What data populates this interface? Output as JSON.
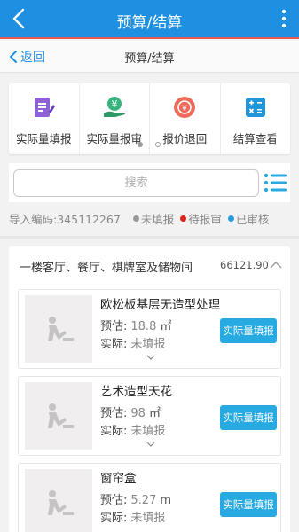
{
  "appbar": {
    "title": "预算/结算"
  },
  "subbar": {
    "back_label": "返回",
    "title": "预算/结算"
  },
  "actions": [
    {
      "label": "实际量填报",
      "icon": "edit-icon",
      "color": "#8e62d6"
    },
    {
      "label": "实际量报审",
      "icon": "money-hand-icon",
      "color": "#36b37e"
    },
    {
      "label": "报价退回",
      "icon": "return-icon",
      "color": "#ef6a5c"
    },
    {
      "label": "结算查看",
      "icon": "calculator-icon",
      "color": "#2196d8"
    }
  ],
  "search": {
    "placeholder": "搜索"
  },
  "legend": {
    "code": "导入编码:345112267",
    "statuses": [
      {
        "label": "未填报",
        "color": "#999999"
      },
      {
        "label": "待报审",
        "color": "#d9231b"
      },
      {
        "label": "已审核",
        "color": "#2b9be0"
      }
    ]
  },
  "section": {
    "title": "一楼客厅、餐厅、棋牌室及储物间",
    "total": "66121.90",
    "items": [
      {
        "name": "欧松板基层无造型处理",
        "est_label": "预估:",
        "est_value": "18.8",
        "est_unit": "㎡",
        "act_label": "实际:",
        "act_value": "未填报",
        "button": "实际量填报"
      },
      {
        "name": "艺术造型天花",
        "est_label": "预估:",
        "est_value": "98",
        "est_unit": "㎡",
        "act_label": "实际:",
        "act_value": "未填报",
        "button": "实际量填报"
      },
      {
        "name": "窗帘盒",
        "est_label": "预估:",
        "est_value": "5.27",
        "est_unit": "m",
        "act_label": "实际:",
        "act_value": "未填报",
        "button": "实际量填报"
      }
    ]
  }
}
